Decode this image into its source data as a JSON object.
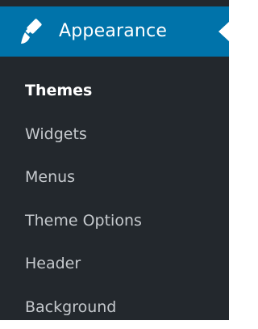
{
  "menu": {
    "header": {
      "label": "Appearance",
      "icon": "paintbrush-icon"
    },
    "items": [
      {
        "label": "Themes",
        "current": true
      },
      {
        "label": "Widgets",
        "current": false
      },
      {
        "label": "Menus",
        "current": false
      },
      {
        "label": "Theme Options",
        "current": false
      },
      {
        "label": "Header",
        "current": false
      },
      {
        "label": "Background",
        "current": false
      }
    ]
  },
  "colors": {
    "sidebar_background": "#23282d",
    "active_header": "#0073aa",
    "text_default": "#c5c9cd",
    "text_active": "#ffffff"
  }
}
